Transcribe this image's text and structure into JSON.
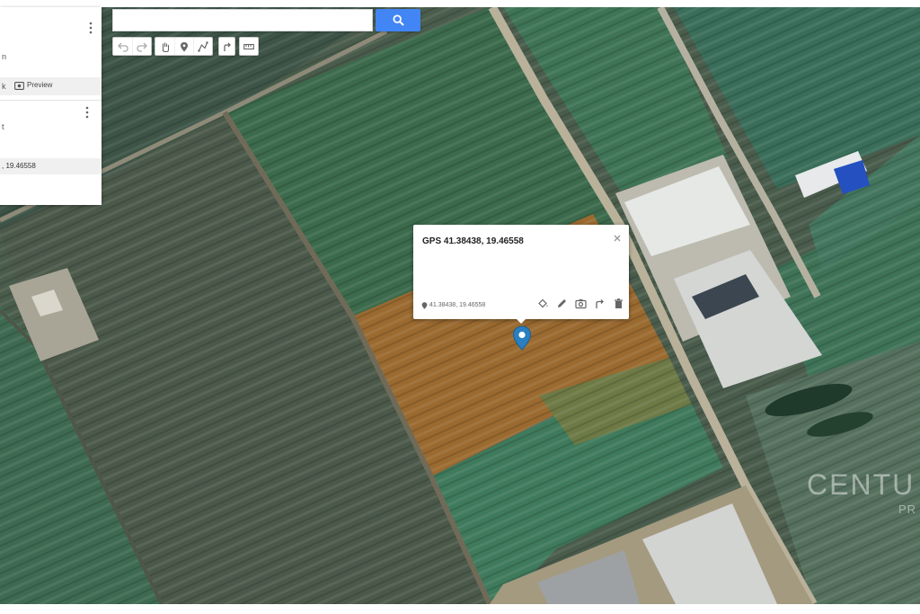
{
  "search": {
    "value": "",
    "placeholder": ""
  },
  "search_button": {
    "icon": "search-icon"
  },
  "toolbar": {
    "groups": [
      [
        "undo-icon",
        "redo-icon"
      ],
      [
        "hand-select-icon",
        "add-marker-icon",
        "draw-line-icon"
      ],
      [
        "directions-icon"
      ],
      [
        "ruler-icon"
      ]
    ]
  },
  "left_panel": {
    "menu_icon": "more-vert-icon",
    "title_fragment": "n",
    "share_fragment": "k",
    "preview_icon": "preview-icon",
    "preview_label": "Preview",
    "layer_menu_icon": "more-vert-icon",
    "layer_fragment": "t",
    "selected_item": ", 19.46558"
  },
  "popup": {
    "title": "GPS 41.38438, 19.46558",
    "close_icon": "close-icon",
    "coordinates_icon": "location-icon",
    "coordinates": "41.38438, 19.46558",
    "actions": [
      "style-icon",
      "edit-icon",
      "add-photo-icon",
      "directions-icon",
      "delete-icon"
    ]
  },
  "marker": {
    "icon": "map-pin-icon",
    "color": "#2a7fc1"
  },
  "watermark": {
    "line1": "CENTU",
    "line2": "PR"
  },
  "colors": {
    "accent": "#4285f4",
    "marker": "#2a7fc1",
    "highlighted_field": "#9a6a30"
  }
}
